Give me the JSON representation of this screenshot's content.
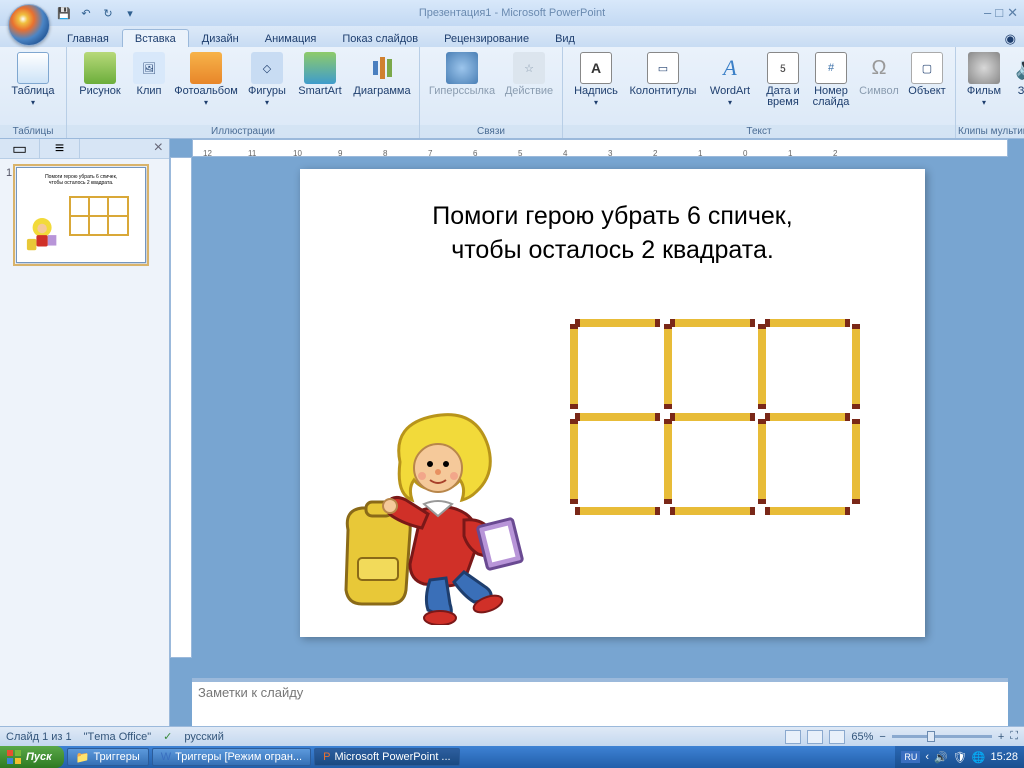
{
  "app": {
    "title": "Презентация1 - Microsoft PowerPoint"
  },
  "qat": {
    "save": "💾",
    "undo": "↶",
    "redo": "↷"
  },
  "win": {
    "min": "–",
    "max": "□",
    "close": "✕"
  },
  "tabs": {
    "home": "Главная",
    "insert": "Вставка",
    "design": "Дизайн",
    "anim": "Анимация",
    "show": "Показ слайдов",
    "review": "Рецензирование",
    "view": "Вид"
  },
  "ribbon": {
    "groups": {
      "tables": "Таблицы",
      "illus": "Иллюстрации",
      "links": "Связи",
      "text": "Текст",
      "media": "Клипы мультимедиа"
    },
    "btn": {
      "table": "Таблица",
      "pic": "Рисунок",
      "clip": "Клип",
      "album": "Фотоальбом",
      "shapes": "Фигуры",
      "smart": "SmartArt",
      "chart": "Диаграмма",
      "hyperlink": "Гиперссылка",
      "action": "Действие",
      "textbox": "Надпись",
      "hf": "Колонтитулы",
      "wart": "WordArt",
      "date": "Дата и время",
      "num": "Номер слайда",
      "sym": "Символ",
      "obj": "Объект",
      "movie": "Фильм",
      "sound": "Звук"
    }
  },
  "slide": {
    "title_l1": "Помоги герою убрать 6 спичек,",
    "title_l2": "чтобы осталось 2 квадрата."
  },
  "notes": {
    "placeholder": "Заметки к слайду"
  },
  "status": {
    "slide": "Слайд 1 из 1",
    "theme": "\"Тema Office\"",
    "lang": "русский",
    "zoom": "65%"
  },
  "taskbar": {
    "start": "Пуск",
    "t1": "Триггеры",
    "t2": "Триггеры [Режим огран...",
    "t3": "Microsoft PowerPoint ...",
    "lang_ind": "RU",
    "time": "15:28"
  }
}
